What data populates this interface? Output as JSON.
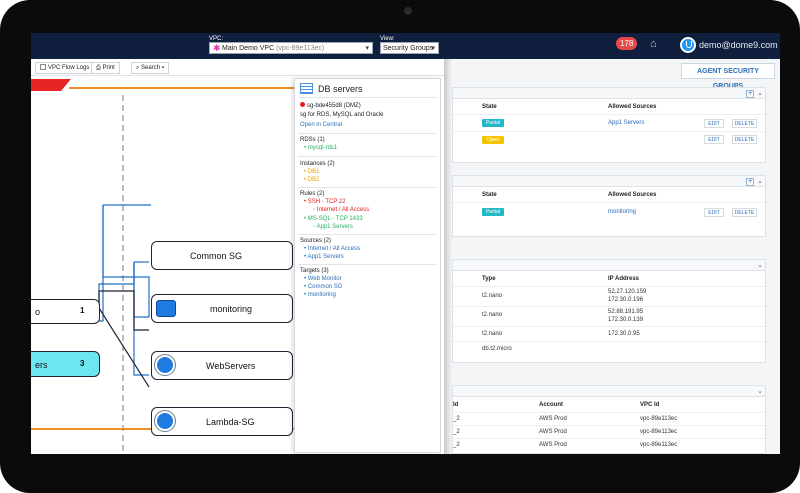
{
  "topbar": {
    "vpc_label": "VPC:",
    "vpc_name": "Main Demo VPC",
    "vpc_id": "(vpc-89e113ec)",
    "view_label": "View:",
    "view_value": "Security Groups",
    "notifications": "178",
    "user_email": "demo@dome9.com"
  },
  "toolbar": {
    "flow_logs": "VPC Flow Logs",
    "print": "Print",
    "search": "Search"
  },
  "canvas": {
    "nodes": [
      {
        "label": "o",
        "count": "1"
      },
      {
        "label": "ers",
        "count": "3"
      },
      {
        "label": "Common SG"
      },
      {
        "label": "monitoring"
      },
      {
        "label": "WebServers"
      },
      {
        "label": "Lambda-SG"
      }
    ]
  },
  "info": {
    "title": "DB servers",
    "sg_id": "sg-bde455d8 (DMZ)",
    "description": "sg for RDS, MySQL and Oracle",
    "open_central": "Open in Central",
    "rds_header": "RDSs (1)",
    "rds": [
      "mysql-rds1"
    ],
    "instances_header": "Instances (2)",
    "instances": [
      "DB1",
      "DB2"
    ],
    "rules_header": "Rules (2)",
    "rule1": "SSH - TCP 22",
    "rule1_src": "Internet / All Access",
    "rule2": "MS-SQL - TCP 1433",
    "rule2_src": "App1 Servers",
    "sources_header": "Sources (2)",
    "sources": [
      "Internet / All Access",
      "App1 Servers"
    ],
    "targets_header": "Targets (3)",
    "targets": [
      "Web Monitor",
      "Common SG",
      "monitoring"
    ]
  },
  "right": {
    "agent_button": "AGENT SECURITY GROUPS",
    "panel1": {
      "headers": {
        "state": "State",
        "sources": "Allowed Sources"
      },
      "rows": [
        {
          "state": "Partial",
          "state_color": "#22b8c8",
          "source": "App1 Servers"
        },
        {
          "state": "Open",
          "state_color": "#f5c400",
          "source": ""
        }
      ]
    },
    "panel2": {
      "headers": {
        "state": "State",
        "sources": "Allowed Sources"
      },
      "rows": [
        {
          "state": "Partial",
          "state_color": "#22b8c8",
          "source": "monitoring"
        }
      ]
    },
    "panel3": {
      "headers": {
        "type": "Type",
        "ip": "IP Address"
      },
      "rows": [
        {
          "type": "t2.nano",
          "ip1": "52.27.120.159",
          "ip2": "172.30.0.196"
        },
        {
          "type": "t2.nano",
          "ip1": "52.88.191.95",
          "ip2": "172.30.0.139"
        },
        {
          "type": "t2.nano",
          "ip1": "172.30.0.95",
          "ip2": ""
        },
        {
          "type": "db.t2.micro",
          "ip1": "",
          "ip2": ""
        }
      ]
    },
    "panel4": {
      "headers": {
        "id": "Id",
        "account": "Account",
        "vpc": "VPC Id"
      },
      "rows": [
        {
          "id": "_2",
          "account": "AWS Prod",
          "vpc": "vpc-89e113ec"
        },
        {
          "id": "_2",
          "account": "AWS Prod",
          "vpc": "vpc-89e113ec"
        },
        {
          "id": "_2",
          "account": "AWS Prod",
          "vpc": "vpc-89e113ec"
        }
      ]
    },
    "edit": "EDIT",
    "delete": "DELETE"
  }
}
